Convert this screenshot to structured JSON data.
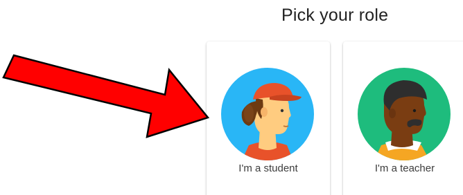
{
  "header": {
    "title": "Pick your role"
  },
  "roles": [
    {
      "label": "I'm a student",
      "icon": "student-avatar-icon"
    },
    {
      "label": "I'm a teacher",
      "icon": "teacher-avatar-icon"
    }
  ],
  "annotation": {
    "icon": "red-arrow-icon",
    "color": "#ff0000"
  },
  "colors": {
    "student_bg": "#29b6f6",
    "teacher_bg": "#1ebc7d",
    "cap": "#e8522a",
    "skin_light": "#ffcc80",
    "skin_dark": "#7a3d12",
    "hair": "#333333"
  }
}
